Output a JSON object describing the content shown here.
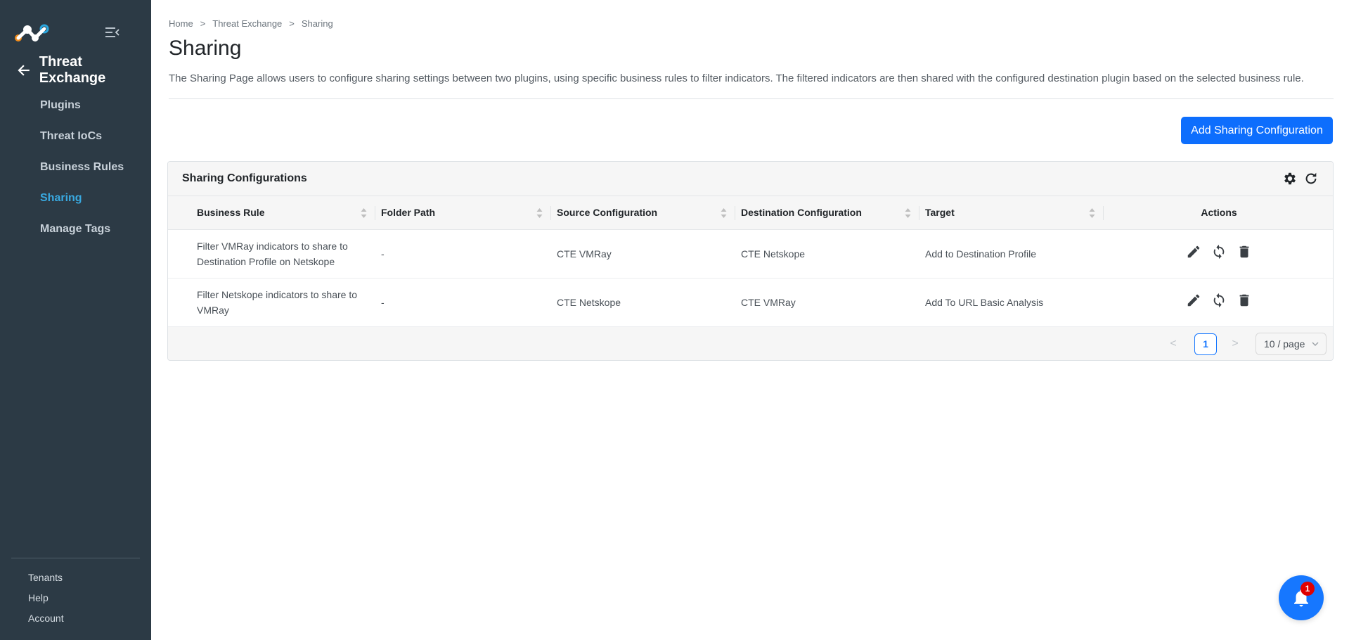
{
  "sidebar": {
    "module_title": "Threat Exchange",
    "items": [
      {
        "label": "Plugins",
        "active": false
      },
      {
        "label": "Threat IoCs",
        "active": false
      },
      {
        "label": "Business Rules",
        "active": false
      },
      {
        "label": "Sharing",
        "active": true
      },
      {
        "label": "Manage Tags",
        "active": false
      }
    ],
    "footer_items": [
      {
        "label": "Tenants"
      },
      {
        "label": "Help"
      },
      {
        "label": "Account"
      }
    ],
    "active_color": "#39a9e0",
    "background": "#2c3a45"
  },
  "breadcrumb": [
    "Home",
    "Threat Exchange",
    "Sharing"
  ],
  "breadcrumb_separator": ">",
  "page": {
    "title": "Sharing",
    "description": "The Sharing Page allows users to configure sharing settings between two plugins, using specific business rules to filter indicators. The filtered indicators are then shared with the configured destination plugin based on the selected business rule.",
    "add_button_label": "Add Sharing Configuration"
  },
  "table": {
    "title": "Sharing Configurations",
    "tool_icons": [
      "gear-icon",
      "refresh-icon"
    ],
    "columns": [
      "Business Rule",
      "Folder Path",
      "Source Configuration",
      "Destination Configuration",
      "Target",
      "Actions"
    ],
    "rows": [
      {
        "business_rule": "Filter VMRay indicators to share to Destination Profile on Netskope",
        "folder_path": "-",
        "source": "CTE VMRay",
        "destination": "CTE Netskope",
        "target": "Add to Destination Profile"
      },
      {
        "business_rule": "Filter Netskope indicators to share to VMRay",
        "folder_path": "-",
        "source": "CTE Netskope",
        "destination": "CTE VMRay",
        "target": "Add To URL Basic Analysis"
      }
    ],
    "row_action_icons": [
      "edit-icon",
      "sync-icon",
      "delete-icon"
    ]
  },
  "pagination": {
    "prev": "<",
    "current_page": "1",
    "next": ">",
    "page_size": "10 / page"
  },
  "notifications": {
    "count": "1",
    "icon": "bell-icon"
  },
  "colors": {
    "primary": "#0d6efd",
    "badge": "#e00000"
  }
}
